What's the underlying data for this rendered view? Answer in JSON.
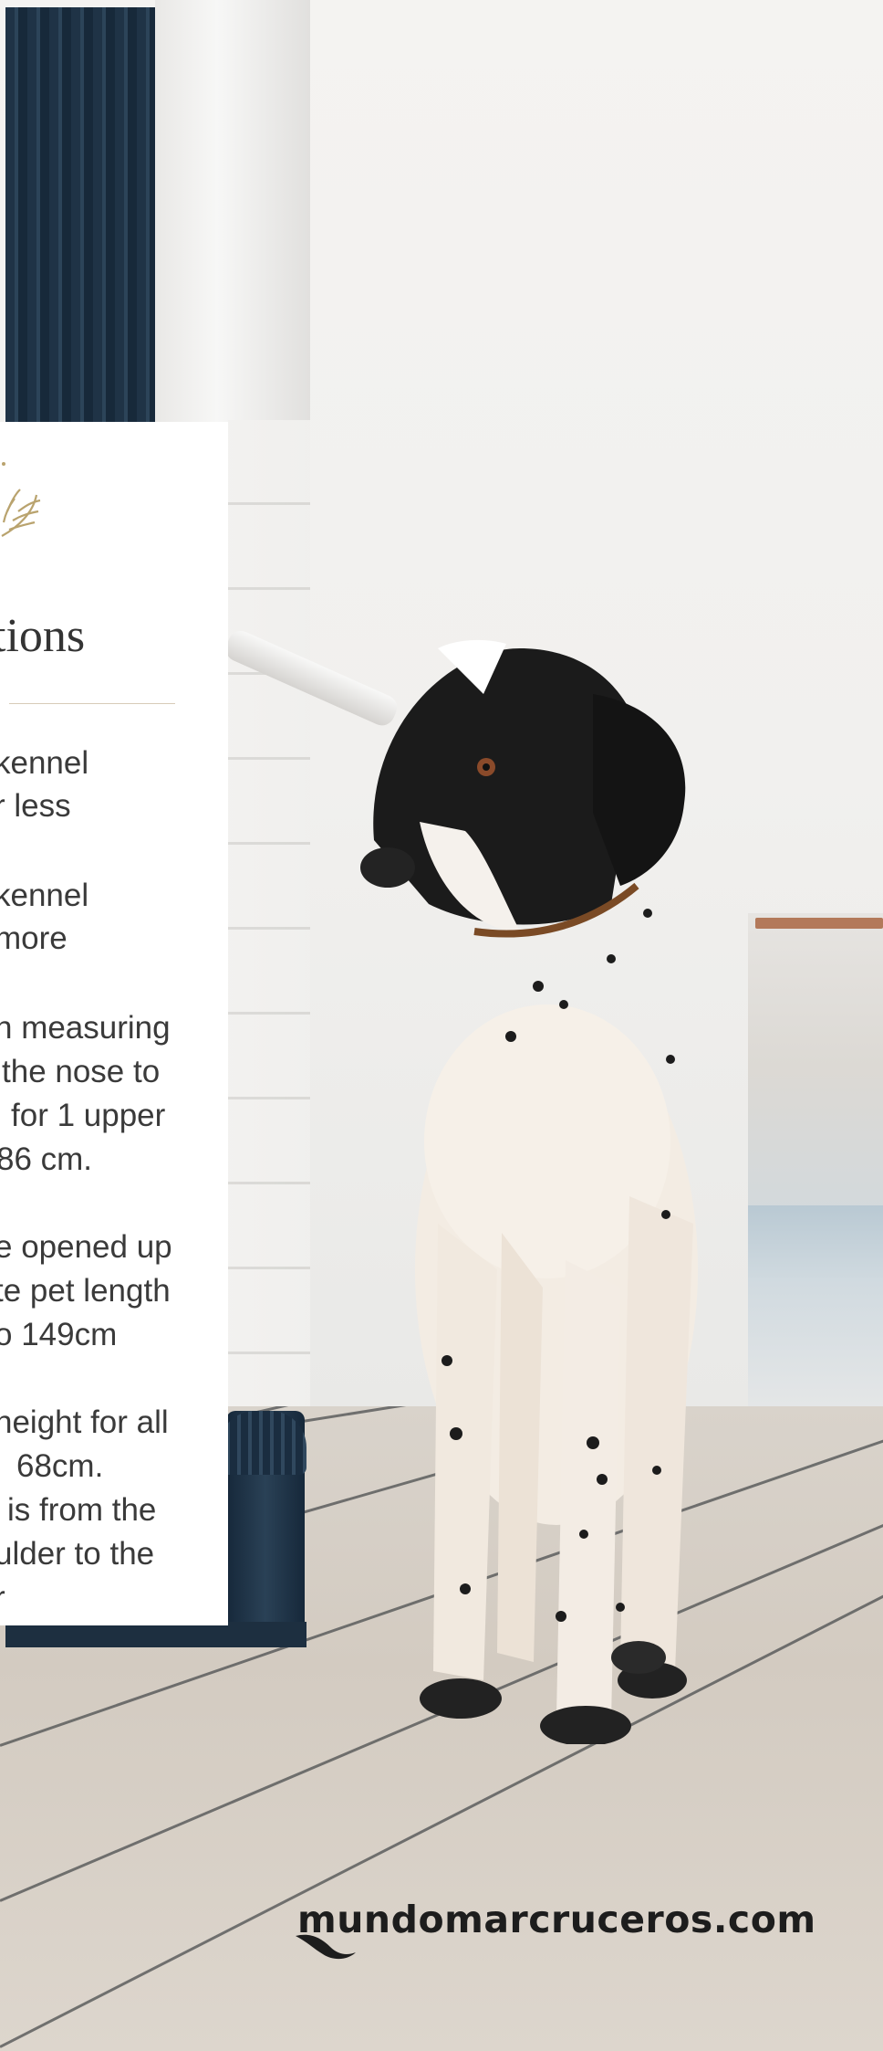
{
  "card": {
    "title": "tions",
    "lines": [
      "kennel",
      "r less",
      "kennel",
      "more",
      "h measuring",
      "the nose to",
      "for 1 upper",
      "86 cm.",
      "e opened up",
      "te pet length",
      "o 149cm",
      "height for all",
      "68cm.",
      "is from the",
      "ulder to the",
      "r"
    ]
  },
  "logo": {
    "text": "mundomarcruceros.com"
  },
  "icons": {
    "crest": "laurel-crest-icon",
    "logo_mark": "wave-swoosh-icon"
  },
  "colors": {
    "card_bg": "#ffffff",
    "text": "#3a3a3a",
    "crest_gold": "#b9a36e",
    "navy": "#1f3346",
    "deck": "#d6cfc6"
  }
}
